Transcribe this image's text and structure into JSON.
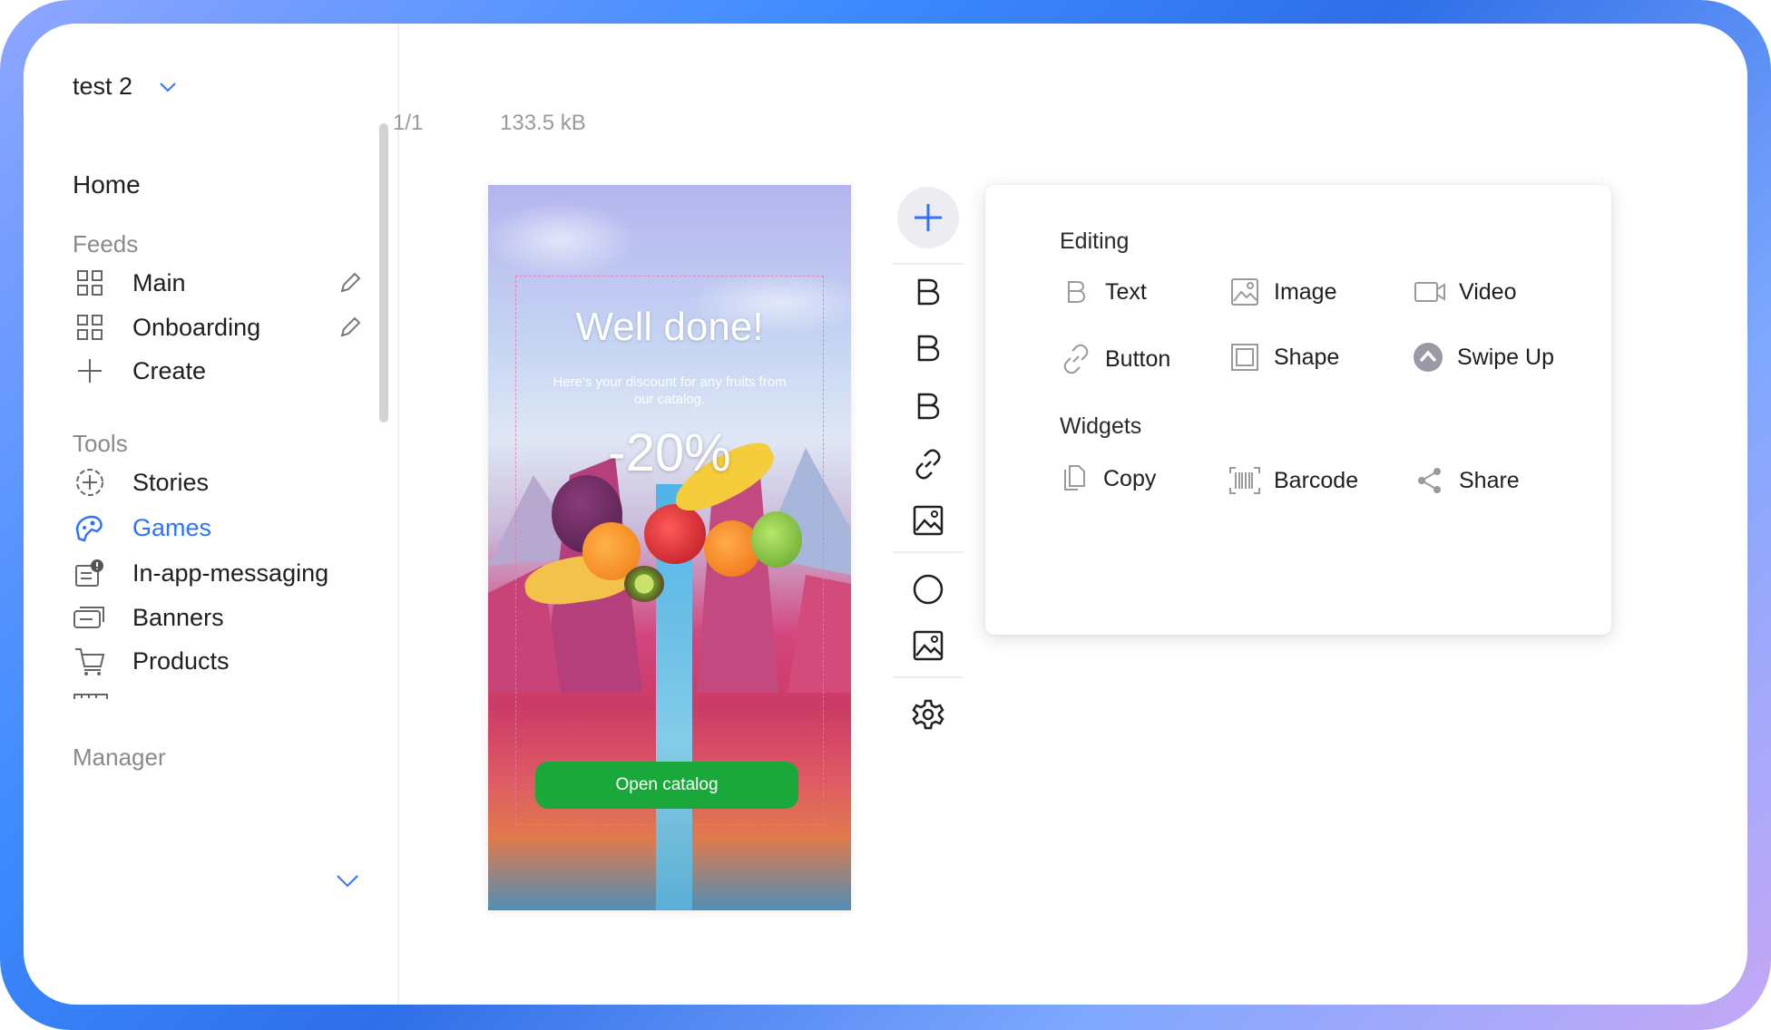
{
  "sidebar": {
    "workspace": "test 2",
    "home": "Home",
    "feeds_label": "Feeds",
    "feeds": [
      {
        "label": "Main",
        "icon": "grid-icon"
      },
      {
        "label": "Onboarding",
        "icon": "grid-icon"
      },
      {
        "label": "Create",
        "icon": "plus-icon"
      }
    ],
    "tools_label": "Tools",
    "tools": [
      {
        "label": "Stories",
        "icon": "plus-circle-icon"
      },
      {
        "label": "Games",
        "icon": "gamepad-icon",
        "active": true
      },
      {
        "label": "In-app-messaging",
        "icon": "message-alert-icon"
      },
      {
        "label": "Banners",
        "icon": "banner-icon"
      },
      {
        "label": "Products",
        "icon": "cart-icon"
      }
    ],
    "manager_label": "Manager"
  },
  "canvas": {
    "page_counter": "1/1",
    "file_size": "133.5 kB"
  },
  "story": {
    "title": "Well done!",
    "subtitle": "Here's your discount for any fruits from our catalog.",
    "discount": "-20%",
    "button_label": "Open catalog",
    "button_color": "#1ba83a"
  },
  "panel": {
    "editing_label": "Editing",
    "editing_items": [
      {
        "label": "Text",
        "icon": "text-icon"
      },
      {
        "label": "Image",
        "icon": "image-icon"
      },
      {
        "label": "Video",
        "icon": "video-icon"
      },
      {
        "label": "Button",
        "icon": "link-icon"
      },
      {
        "label": "Shape",
        "icon": "shape-icon"
      },
      {
        "label": "Swipe Up",
        "icon": "swipe-up-icon"
      }
    ],
    "widgets_label": "Widgets",
    "widget_items": [
      {
        "label": "Copy",
        "icon": "copy-icon"
      },
      {
        "label": "Barcode",
        "icon": "barcode-icon"
      },
      {
        "label": "Share",
        "icon": "share-icon"
      }
    ]
  },
  "colors": {
    "accent": "#2f72ff",
    "frame_gradient_start": "#8fa6ff",
    "frame_gradient_mid": "#2f6fe8",
    "frame_gradient_end": "#c6a8f5"
  }
}
